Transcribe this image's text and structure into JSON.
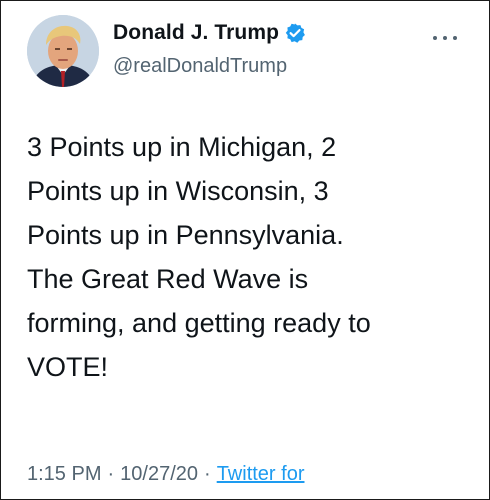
{
  "author": {
    "display_name": "Donald J. Trump",
    "handle": "@realDonaldTrump",
    "verified": true,
    "avatar_icon": "profile-photo"
  },
  "tweet": {
    "text": "3 Points up in Michigan, 2\nPoints up in Wisconsin, 3\nPoints up in Pennsylvania.\nThe Great Red Wave is\nforming, and getting ready to\nVOTE!",
    "time": "1:15 PM",
    "separator": "·",
    "date": "10/27/20",
    "source": "Twitter for"
  },
  "actions": {
    "more_icon": "more-horizontal-icon"
  },
  "colors": {
    "text": "#0f1419",
    "secondary": "#536471",
    "link": "#1d9bf0",
    "verified": "#1d9bf0"
  }
}
